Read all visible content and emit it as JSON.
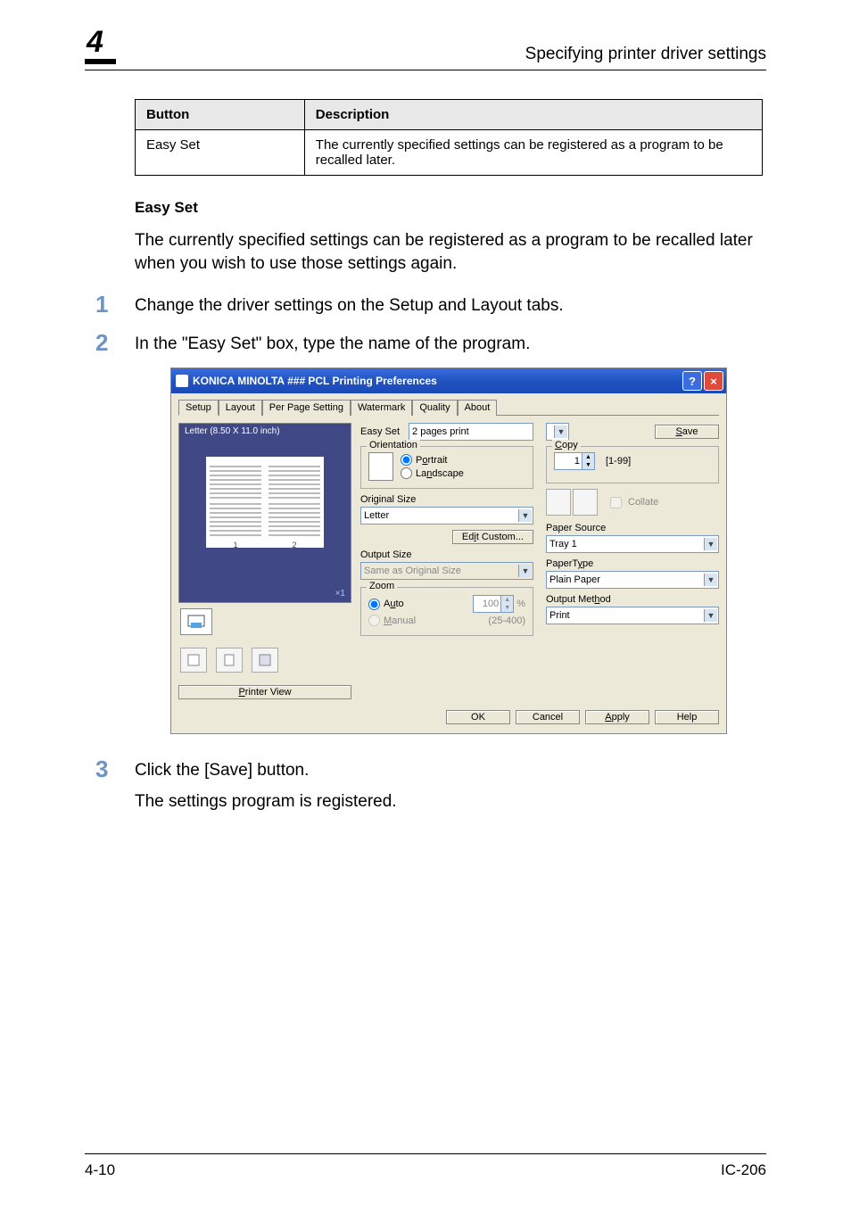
{
  "header": {
    "chapter": "4",
    "title": "Specifying printer driver settings"
  },
  "table": {
    "head_button": "Button",
    "head_desc": "Description",
    "row_button": "Easy Set",
    "row_desc": "The currently specified settings can be registered as a program to be recalled later."
  },
  "section": {
    "title": "Easy Set",
    "intro": "The currently specified settings can be registered as a program to be recalled later when you wish to use those settings again.",
    "step1": "Change the driver settings on the Setup and Layout tabs.",
    "step2": "In the \"Easy Set\" box, type the name of the program.",
    "step3": "Click the [Save] button.",
    "result": "The settings program is registered."
  },
  "dialog": {
    "title_prefix": "KONICA MINOLTA ",
    "title_suffix": " PCL Printing Preferences",
    "tabs": [
      "Setup",
      "Layout",
      "Per Page Setting",
      "Watermark",
      "Quality",
      "About"
    ],
    "preview_label": "Letter  (8.50 X 11.0 inch)",
    "printer_view": "Printer View",
    "easy_set_label": "Easy Set",
    "easy_set_value": "2 pages print",
    "save_btn": "Save",
    "orientation": {
      "legend": "Orientation",
      "portrait": "Portrait",
      "landscape": "Landscape"
    },
    "original_size_label": "Original Size",
    "original_size_value": "Letter",
    "edit_custom": "Edit Custom...",
    "output_size_label": "Output Size",
    "output_size_value": "Same as Original Size",
    "zoom": {
      "legend": "Zoom",
      "auto": "Auto",
      "manual": "Manual",
      "value": "100",
      "unit": "%",
      "range": "(25-400)"
    },
    "copy": {
      "legend": "Copy",
      "value": "1",
      "range": "[1-99]"
    },
    "collate": "Collate",
    "paper_source_label": "Paper Source",
    "paper_source_value": "Tray 1",
    "paper_type_label": "PaperType",
    "paper_type_value": "Plain Paper",
    "output_method_label": "Output Method",
    "output_method_value": "Print",
    "buttons": {
      "ok": "OK",
      "cancel": "Cancel",
      "apply": "Apply",
      "help": "Help"
    },
    "x1": "×1"
  },
  "footer": {
    "left": "4-10",
    "right": "IC-206"
  },
  "steps": {
    "n1": "1",
    "n2": "2",
    "n3": "3"
  }
}
